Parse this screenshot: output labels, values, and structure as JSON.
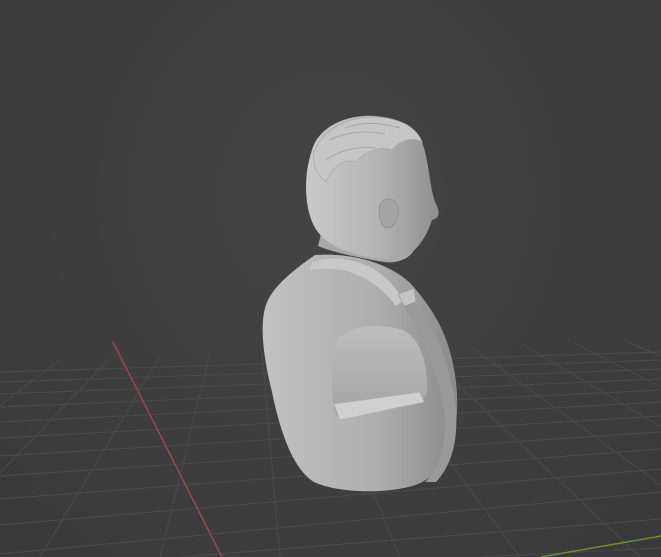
{
  "viewport": {
    "background_color": "#3d3d3d",
    "grid_color": "#4a4a4a",
    "x_axis_color": "#b8465a",
    "y_axis_color": "#7a9a3c",
    "model_color": "#b9b9b9",
    "object": "bust-sculpt",
    "grid_visible": true
  }
}
